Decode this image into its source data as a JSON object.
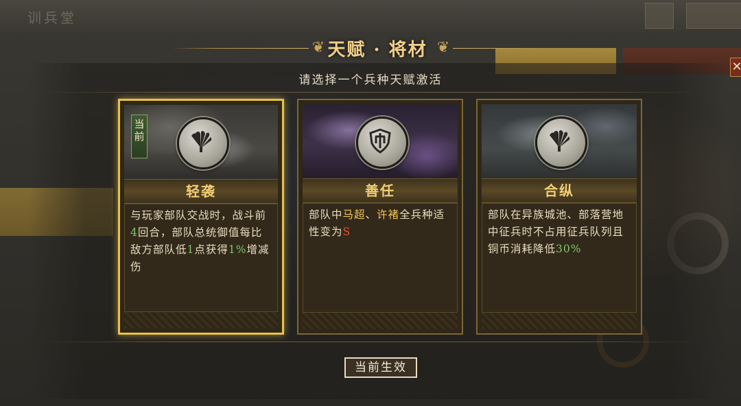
{
  "header": {
    "bg_title": "训兵堂"
  },
  "modal": {
    "title": "天赋 · 将材",
    "subtitle": "请选择一个兵种天赋激活",
    "close_glyph": "✕"
  },
  "cards": [
    {
      "name": "轻袭",
      "current_tag": "当前",
      "emblem": "fan-icon",
      "selected": true,
      "desc": [
        "与玩家部队交战时，战斗前",
        "4",
        "回合，部队总统御值每比敌方部队低",
        "1",
        "点获得",
        "1%",
        "增减伤"
      ]
    },
    {
      "name": "善任",
      "emblem": "shield-icon",
      "selected": false,
      "desc": [
        "部队中",
        "马超",
        "、",
        "许褚",
        "全兵种适性变为",
        "S"
      ]
    },
    {
      "name": "合纵",
      "emblem": "fan-icon",
      "selected": false,
      "desc": [
        "部队在异族城池、部落营地中征兵时不占用征兵队列且铜币消耗降低",
        "30%"
      ]
    }
  ],
  "footer": {
    "effect_button": "当前生效"
  },
  "colors": {
    "gold": "#f2cf75",
    "green": "#7bc86e",
    "red": "#e8533a",
    "selected_border": "#e8c24a"
  }
}
